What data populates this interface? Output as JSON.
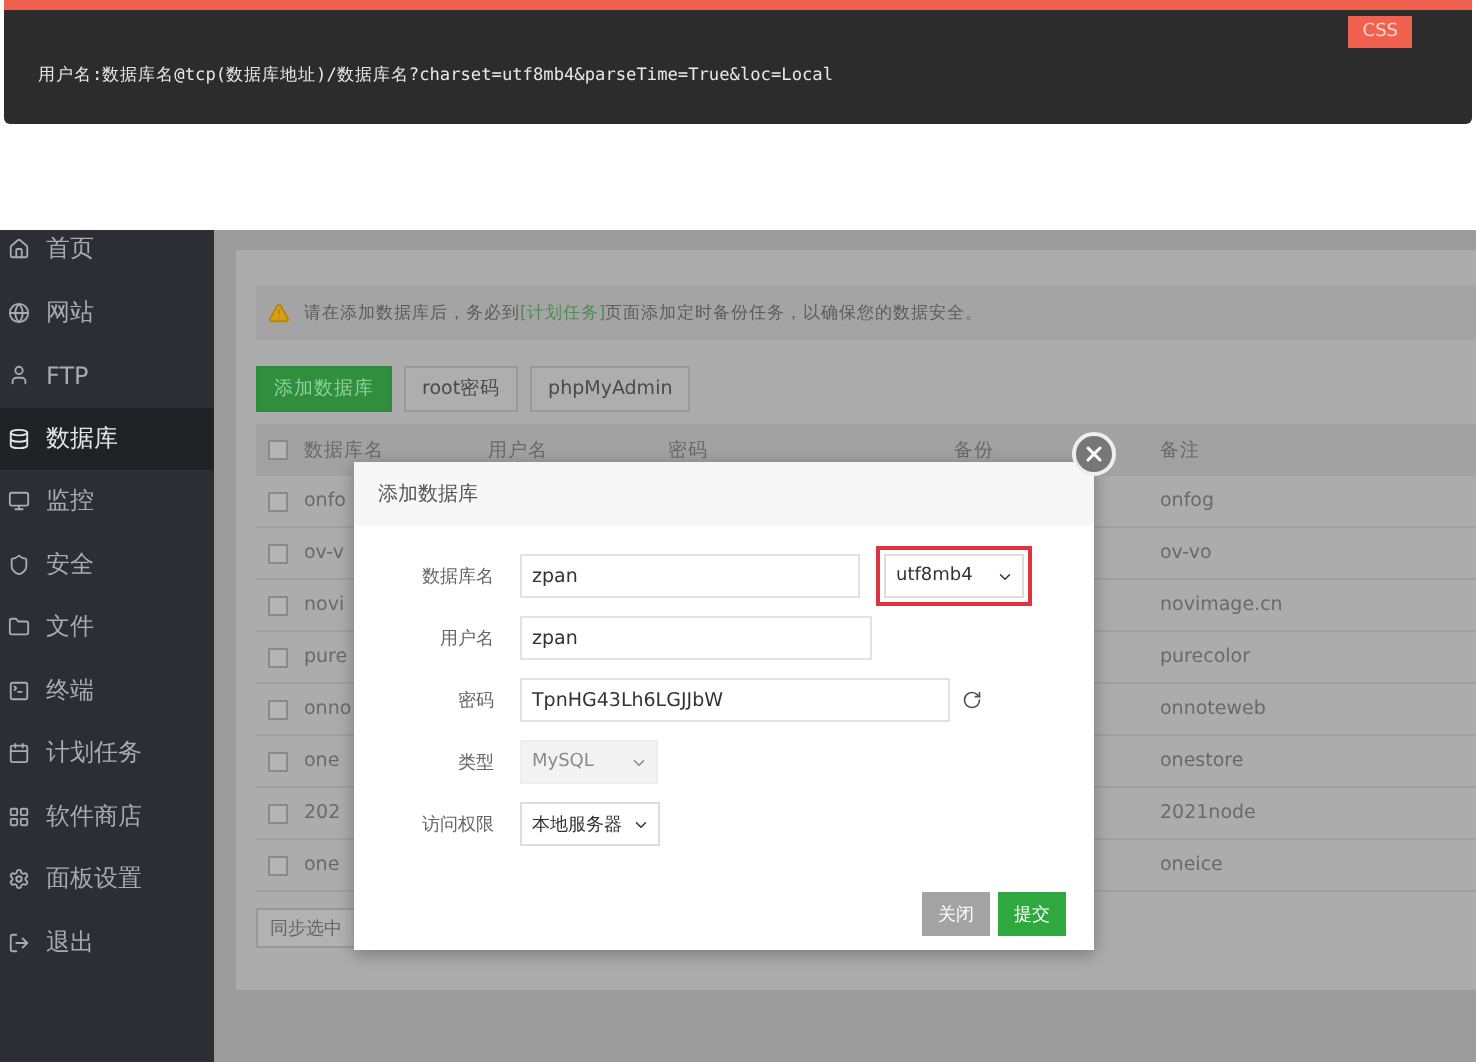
{
  "code_block": {
    "badge": "CSS",
    "code": "用户名:数据库名@tcp(数据库地址)/数据库名?charset=utf8mb4&parseTime=True&loc=Local"
  },
  "sidebar": {
    "items": [
      {
        "label": "首页",
        "selected": false
      },
      {
        "label": "网站",
        "selected": false
      },
      {
        "label": "FTP",
        "selected": false
      },
      {
        "label": "数据库",
        "selected": true
      },
      {
        "label": "监控",
        "selected": false
      },
      {
        "label": "安全",
        "selected": false
      },
      {
        "label": "文件",
        "selected": false
      },
      {
        "label": "终端",
        "selected": false
      },
      {
        "label": "计划任务",
        "selected": false
      },
      {
        "label": "软件商店",
        "selected": false
      },
      {
        "label": "面板设置",
        "selected": false
      },
      {
        "label": "退出",
        "selected": false
      }
    ]
  },
  "alert": {
    "before": "请在添加数据库后，务必到",
    "link": "[计划任务]",
    "after": "页面添加定时备份任务，以确保您的数据安全。"
  },
  "toolbar": [
    {
      "label": "添加数据库",
      "kind": "primary"
    },
    {
      "label": "root密码",
      "kind": "default"
    },
    {
      "label": "phpMyAdmin",
      "kind": "default"
    }
  ],
  "table": {
    "header_checked": false,
    "columns": [
      "数据库名",
      "用户名",
      "密码",
      "备份",
      "备注"
    ],
    "rows": [
      {
        "name": "onfo",
        "note": "onfog",
        "checked": false
      },
      {
        "name": "ov-v",
        "note": "ov-vo",
        "checked": false
      },
      {
        "name": "novi",
        "note": "novimage.cn",
        "checked": false
      },
      {
        "name": "pure",
        "note": "purecolor",
        "checked": false
      },
      {
        "name": "onno",
        "note": "onnoteweb",
        "checked": false
      },
      {
        "name": "one",
        "note": "onestore",
        "checked": false
      },
      {
        "name": "202",
        "note": "2021node",
        "checked": false
      },
      {
        "name": "one",
        "note": "oneice",
        "checked": false
      }
    ]
  },
  "sync_button": "同步选中",
  "dialog": {
    "title": "添加数据库",
    "fields": [
      {
        "label": "数据库名",
        "kind": "text",
        "value": "zpan",
        "charset": {
          "value": "utf8mb4",
          "highlighted": true
        }
      },
      {
        "label": "用户名",
        "kind": "text",
        "value": "zpan"
      },
      {
        "label": "密码",
        "kind": "password",
        "value": "TpnHG43Lh6LGJJbW"
      },
      {
        "label": "类型",
        "kind": "select",
        "value": "MySQL",
        "disabled": true
      },
      {
        "label": "访问权限",
        "kind": "select",
        "value": "本地服务器",
        "disabled": false
      }
    ],
    "buttons": [
      {
        "label": "关闭",
        "kind": "secondary"
      },
      {
        "label": "提交",
        "kind": "primary"
      }
    ]
  }
}
